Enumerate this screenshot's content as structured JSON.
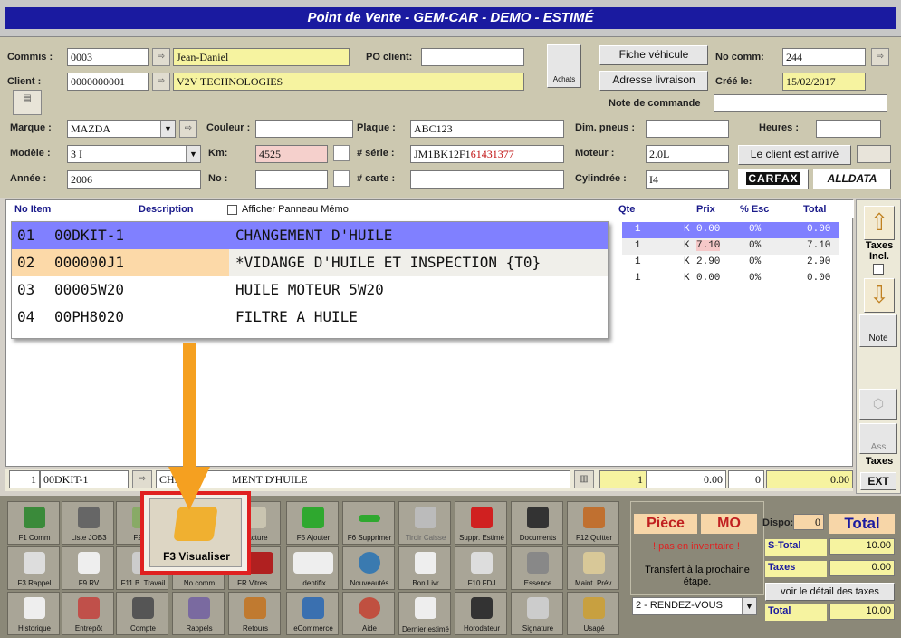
{
  "window": {
    "title": "Point de Vente - GEM-CAR - DEMO - ESTIMÉ"
  },
  "form": {
    "commis_label": "Commis :",
    "commis_code": "0003",
    "commis_name": "Jean-Daniel",
    "client_label": "Client :",
    "client_code": "0000000001",
    "client_name": "V2V TECHNOLOGIES",
    "po_label": "PO client:",
    "po_value": "",
    "achats_label": "Achats",
    "fiche_btn": "Fiche véhicule",
    "adresse_btn": "Adresse livraison",
    "nocomm_label": "No comm:",
    "nocomm_value": "244",
    "cree_label": "Créé le:",
    "cree_value": "15/02/2017",
    "note_cmd_label": "Note de commande",
    "marque_label": "Marque :",
    "marque_value": "MAZDA",
    "couleur_label": "Couleur :",
    "plaque_label": "Plaque :",
    "plaque_value": "ABC123",
    "dim_label": "Dim. pneus :",
    "heures_label": "Heures :",
    "modele_label": "Modèle :",
    "modele_value": "3 I",
    "km_label": "Km:",
    "km_value": "4525",
    "serie_label": "# série :",
    "serie_prefix": "JM1BK12F1",
    "serie_suffix": "61431377",
    "moteur_label": "Moteur :",
    "moteur_value": "2.0L",
    "arrive_btn": "Le client est arrivé",
    "annee_label": "Année :",
    "annee_value": "2006",
    "no_label": "No :",
    "carte_label": "# carte :",
    "cyl_label": "Cylindrée :",
    "cyl_value": "I4",
    "carfax": "CARFAX",
    "alldata": "ALLDATA"
  },
  "list": {
    "headers": {
      "no_item": "No Item",
      "description": "Description",
      "memo": "Afficher Panneau Mémo",
      "qte": "Qte",
      "prix": "Prix",
      "esc": "% Esc",
      "total": "Total"
    },
    "rows": [
      {
        "qte": "1",
        "k": "K",
        "prix": "0.00",
        "esc": "0%",
        "total": "0.00"
      },
      {
        "qte": "1",
        "k": "K",
        "prix": "7.10",
        "esc": "0%",
        "total": "7.10"
      },
      {
        "qte": "1",
        "k": "K",
        "prix": "2.90",
        "esc": "0%",
        "total": "2.90"
      },
      {
        "qte": "1",
        "k": "K",
        "prix": "0.00",
        "esc": "0%",
        "total": "0.00"
      }
    ]
  },
  "popup": {
    "rows": [
      {
        "n": "01",
        "code": "00DKIT-1",
        "desc": "CHANGEMENT D'HUILE"
      },
      {
        "n": "02",
        "code": "000000J1",
        "desc": "*VIDANGE D'HUILE ET INSPECTION {T0}"
      },
      {
        "n": "03",
        "code": "00005W20",
        "desc": "HUILE MOTEUR 5W20"
      },
      {
        "n": "04",
        "code": "00PH8020",
        "desc": "FILTRE A HUILE"
      }
    ]
  },
  "right": {
    "taxes_incl": "Taxes Incl.",
    "note": "Note",
    "ass": "Ass",
    "taxes": "Taxes",
    "ext": "EXT"
  },
  "edit": {
    "qty": "1",
    "code": "00DKIT-1",
    "desc_a": "CHAN",
    "desc_b": "MENT D'HUILE",
    "qte": "1",
    "prix": "0.00",
    "esc": "0",
    "total": "0.00"
  },
  "toolbar": [
    [
      "F1 Comm",
      "Liste JOB3",
      "F2 En",
      "",
      "Facture",
      "F5 Ajouter",
      "F6 Supprimer",
      "Tiroir Caisse",
      "Suppr. Estimé",
      "Documents",
      "F12 Quitter"
    ],
    [
      "F3 Rappel",
      "F9 RV",
      "F11 B. Travail",
      "No comm",
      "FR Vitres...",
      "Identifix",
      "Nouveautés",
      "Bon Livr",
      "F10 FDJ",
      "Essence",
      "Maint. Prév."
    ],
    [
      "Historique",
      "Entrepôt",
      "Compte",
      "Rappels",
      "Retours",
      "eCommerce",
      "Aide",
      "Dernier estimé",
      "Horodateur",
      "Signature",
      "Usagé"
    ]
  ],
  "highlight": {
    "label": "F3 Visualiser"
  },
  "totals": {
    "piece": "Pièce",
    "mo": "MO",
    "dispo_label": "Dispo:",
    "dispo_value": "0",
    "total_label": "Total",
    "pas_inv": "! pas en inventaire !",
    "stotal_label": "S-Total",
    "stotal_value": "10.00",
    "transfert": "Transfert à la prochaine étape.",
    "taxes_label": "Taxes",
    "taxes_value": "0.00",
    "detail_btn": "voir le détail des taxes",
    "etape": "2 - RENDEZ-VOUS",
    "total2_label": "Total",
    "total2_value": "10.00"
  },
  "colors": {
    "title_bar": "#1a1aa0",
    "selection": "#8080ff",
    "highlight_border": "#e02020",
    "arrow": "#f5a020"
  }
}
